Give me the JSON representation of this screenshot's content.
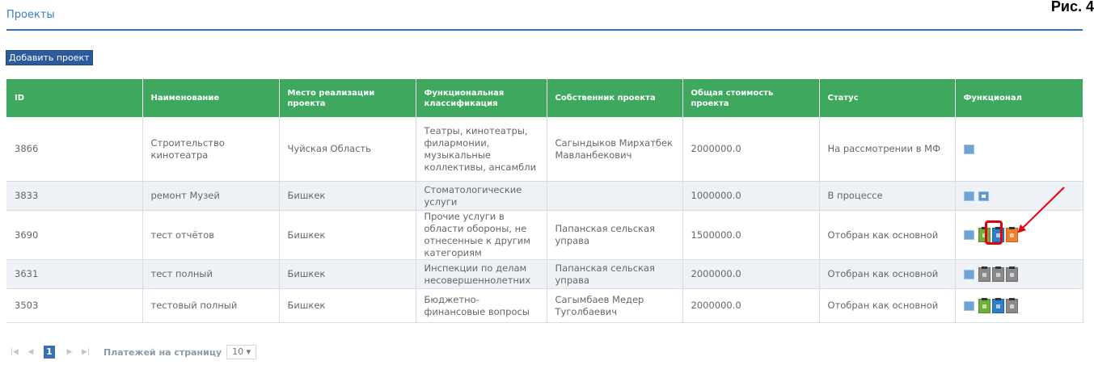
{
  "figure_label": "Рис. 4",
  "page_title": "Проекты",
  "add_button": "Добавить проект",
  "columns": [
    "ID",
    "Наименование",
    "Место реализации проекта",
    "Функциональная классификация",
    "Собственник проекта",
    "Общая стоимость проекта",
    "Статус",
    "Функционал"
  ],
  "rows": [
    {
      "id": "3866",
      "name": "Строительство кинотеатра",
      "place": "Чуйская Область",
      "classification": "Театры, кинотеатры, филармонии, музыкальные коллективы, ансамбли",
      "owner": "Сагындыков Мирхатбек Мавланбекович",
      "cost": "2000000.0",
      "status": "На рассмотрении в МФ",
      "actions": [
        "edit-icon"
      ]
    },
    {
      "id": "3833",
      "name": "ремонт Музей",
      "place": "Бишкек",
      "classification": "Стоматологические услуги",
      "owner": "",
      "cost": "1000000.0",
      "status": "В процессе",
      "actions": [
        "edit-icon",
        "delete-icon"
      ]
    },
    {
      "id": "3690",
      "name": "тест отчётов",
      "place": "Бишкек",
      "classification": "Прочие услуги в области обороны, не отнесенные к другим категориям",
      "owner": "Папанская сельская управа",
      "cost": "1500000.0",
      "status": "Отобран как основной",
      "actions": [
        "edit-icon",
        "report-green-icon",
        "report-blue-icon",
        "report-orange-icon"
      ]
    },
    {
      "id": "3631",
      "name": "тест полный",
      "place": "Бишкек",
      "classification": "Инспекции по делам несовершеннолетних",
      "owner": "Папанская сельская управа",
      "cost": "2000000.0",
      "status": "Отобран как основной",
      "actions": [
        "edit-icon",
        "report-gray-icon",
        "report-gray-icon",
        "report-gray-icon"
      ]
    },
    {
      "id": "3503",
      "name": "тестовый полный",
      "place": "Бишкек",
      "classification": "Бюджетно-финансовые вопросы",
      "owner": "Сагымбаев Медер Туголбаевич",
      "cost": "2000000.0",
      "status": "Отобран как основной",
      "actions": [
        "edit-icon",
        "report-green-icon",
        "report-blue-icon",
        "report-gray-icon"
      ]
    }
  ],
  "pagination": {
    "current_page": "1",
    "per_page_label": "Платежей на страницу",
    "per_page_value": "10"
  },
  "colors": {
    "header_green": "#3da85e",
    "accent_blue": "#3a6fb3",
    "highlight_red": "#e3000f"
  }
}
